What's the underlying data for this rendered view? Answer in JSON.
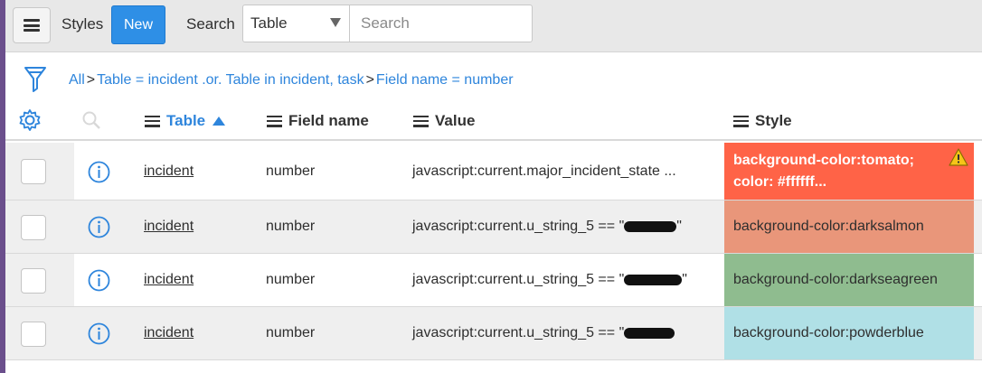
{
  "header": {
    "title": "Styles",
    "new_label": "New",
    "search_label": "Search",
    "search_field_selected": "Table",
    "search_placeholder": "Search"
  },
  "breadcrumb": {
    "items": [
      "All",
      "Table = incident .or. Table in incident, task",
      "Field name = number"
    ],
    "separator": ">"
  },
  "columns": {
    "table": "Table",
    "field_name": "Field name",
    "value": "Value",
    "style": "Style"
  },
  "rows": [
    {
      "table": "incident",
      "field_name": "number",
      "value": "javascript:current.major_incident_state ...",
      "style_line1": "background-color:tomato;",
      "style_line2": "color: #ffffff...",
      "style_bg": "#ff6347"
    },
    {
      "table": "incident",
      "field_name": "number",
      "value": "javascript:current.u_string_5 == \"",
      "value_tail": "\"",
      "style": "background-color:darksalmon",
      "style_bg": "#e9967a"
    },
    {
      "table": "incident",
      "field_name": "number",
      "value": "javascript:current.u_string_5 == \"",
      "value_tail": "\"",
      "style": "background-color:darkseagreen",
      "style_bg": "#8fbc8f"
    },
    {
      "table": "incident",
      "field_name": "number",
      "value": "javascript:current.u_string_5 == \"",
      "value_tail": "",
      "style": "background-color:powderblue",
      "style_bg": "#b0e0e6"
    }
  ],
  "colors": {
    "accent": "#2e8fe6",
    "link": "#2e85dc",
    "warning": "#f5c518"
  }
}
